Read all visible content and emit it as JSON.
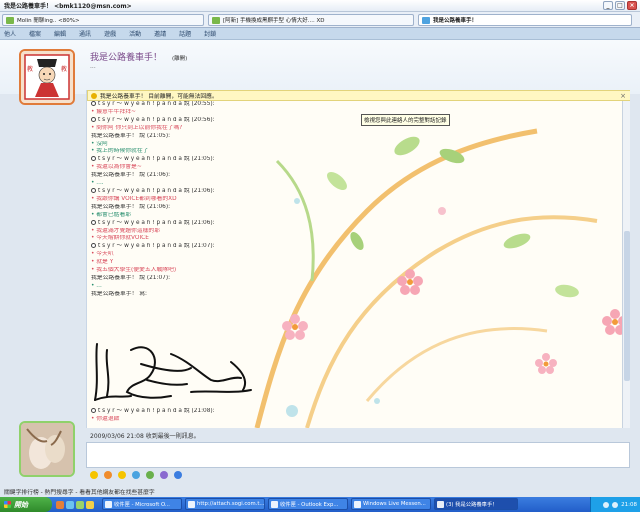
{
  "window": {
    "title": "我是公路養車手！ <bmk1120@msn.com>",
    "buttons": {
      "minimize": "_",
      "maximize": "□",
      "close": "×"
    }
  },
  "tabs": [
    {
      "label": "Molin 閒聊ing.. <80%>"
    },
    {
      "label": "[阿新] 手機換成黑麒手型 心情大好.... XD"
    },
    {
      "label": "我是公路養車手！"
    }
  ],
  "menu": [
    "他人",
    "檔案",
    "編輯",
    "通訊",
    "遊戲",
    "活動",
    "邀請",
    "話題",
    "封鎖"
  ],
  "contact": {
    "name": "我是公路養車手！",
    "status": "(離開)",
    "personal_message": "..."
  },
  "notice": {
    "text": "我是公路養車手！ 目前離開，可能無法回應。",
    "close": "×"
  },
  "tooltip": "檢視您與此連絡人的完整對話記錄",
  "messages": [
    {
      "kind": "h",
      "text": "t s y r ～ w y e a h ! p a n d a 說 (20:55):"
    },
    {
      "kind": "r",
      "text": "• 饅意牛牛拜拜~"
    },
    {
      "kind": "h",
      "text": "t s y r ～ w y e a h ! p a n d a 說 (20:56):"
    },
    {
      "kind": "r",
      "text": "• 問你阿 你只到上以前你我在了嗎?"
    },
    {
      "kind": "s",
      "text": "我是公路養車手！ 說 (21:05):"
    },
    {
      "kind": "t",
      "text": "• 沒阿"
    },
    {
      "kind": "t",
      "text": "• 我上的時候你就在了"
    },
    {
      "kind": "h",
      "text": "t s y r ～ w y e a h ! p a n d a 說 (21:05):"
    },
    {
      "kind": "r",
      "text": "• 我還以為你會是~"
    },
    {
      "kind": "s",
      "text": "我是公路養車手！ 說 (21:06):"
    },
    {
      "kind": "t",
      "text": "• ...."
    },
    {
      "kind": "h",
      "text": "t s y r ～ w y e a h ! p a n d a 說 (21:06):"
    },
    {
      "kind": "r",
      "text": "• 我跟你講 VOICE都到哪看的XD"
    },
    {
      "kind": "s",
      "text": "我是公路養車手！ 說 (21:06):"
    },
    {
      "kind": "t",
      "text": "• 都會已骷看耶"
    },
    {
      "kind": "h",
      "text": "t s y r ～ w y e a h ! p a n d a 說 (21:06):"
    },
    {
      "kind": "r",
      "text": "• 我還滿才覺題你這樣的耶"
    },
    {
      "kind": "r",
      "text": "• 今天嚐餅你就VOICE"
    },
    {
      "kind": "h",
      "text": "t s y r ～ w y e a h ! p a n d a 說 (21:07):"
    },
    {
      "kind": "r",
      "text": "• 今天叭"
    },
    {
      "kind": "r",
      "text": "• 就是 Y"
    },
    {
      "kind": "r",
      "text": "• 我五個大學生(便愛五人戰隊吧)"
    },
    {
      "kind": "s",
      "text": "我是公路養車手！ 說 (21:07):"
    },
    {
      "kind": "t",
      "text": "• ..."
    },
    {
      "kind": "s",
      "text": "我是公路養車手！ 寫:"
    }
  ],
  "last_message": {
    "header": "t s y r ～ w y e a h ! p a n d a 說 (21:08):",
    "text": "• 你還退啟"
  },
  "received_line": "2009/03/06 21:08 收到最後一則訊息。",
  "promo": "關鍵字排行榜 - 熱門搜尋字 - 看看其他網友都在找些甚麼字",
  "taskbar": {
    "start": "開始",
    "buttons": [
      "收件匣 - Microsoft O...",
      "http://attach.sogi.com.t...",
      "收件匣 - Outlook Exp...",
      "Windows Live Messen...",
      "(3) 我是公路養車手！"
    ],
    "clock": "21:08"
  },
  "colors": {
    "accent": "#3b7de0",
    "name": "#7a4a8a",
    "red_text": "#d94a5b",
    "teal_text": "#2a8f6f"
  }
}
